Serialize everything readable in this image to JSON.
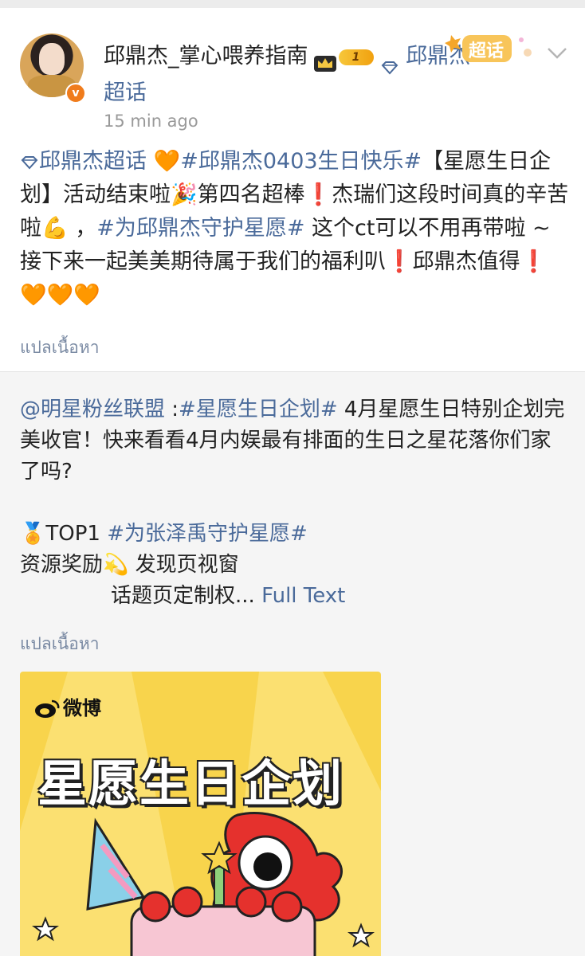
{
  "post": {
    "username": "邱鼎杰_掌心喂养指南",
    "level": "1",
    "supertopic_label": "邱鼎杰超话",
    "supertopic_sticker": "超话",
    "timestamp": "15 min ago",
    "body": {
      "seg1": "邱鼎杰超话 ",
      "seg2": "#邱鼎杰0403生日快乐#",
      "seg3": "【星愿生日企划】活动结束啦🎉第四名超棒",
      "seg4": "杰瑞们这段时间真的辛苦啦💪 ，",
      "seg5": "#为邱鼎杰守护星愿#",
      "seg6": " 这个ct可以不用再带啦 ~ 接下来一起美美期待属于我们的福利叭",
      "seg7": "邱鼎杰值得",
      "excl": "❗",
      "heart": "🧡",
      "hearts3": "🧡🧡🧡"
    },
    "translate_label": "แปลเนื้อหา"
  },
  "repost": {
    "mention": "@明星粉丝联盟",
    "sep": " :",
    "topic": "#星愿生日企划#",
    "text1": " 4月星愿生日特别企划完美收官！快来看看4月内娱最有排面的生日之星花落你们家了吗?",
    "top_label": "TOP1",
    "top_topic": "#为张泽禹守护星愿#",
    "line_reward": "资源奖励💫 发现页视窗",
    "line_more": "话题页定制权...",
    "full_text": "Full Text",
    "translate_label": "แปลเนื้อหา",
    "image": {
      "logo_text": "微博",
      "title": "星愿生日企划"
    }
  }
}
